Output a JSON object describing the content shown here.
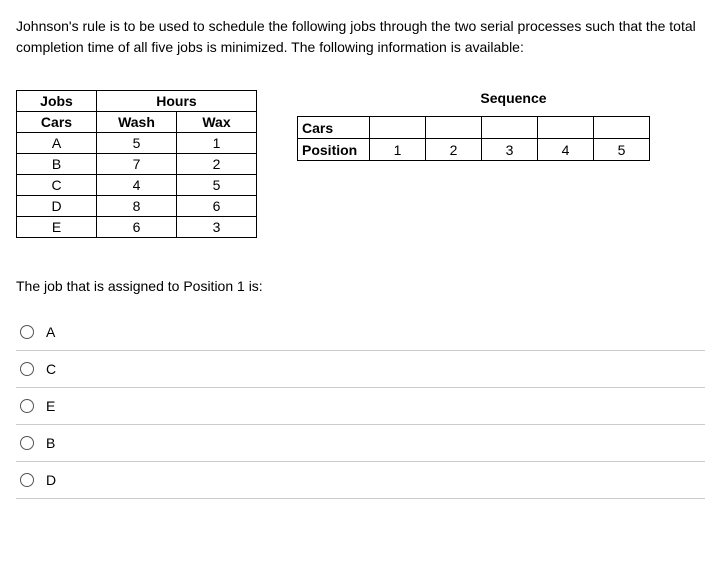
{
  "intro": "Johnson's rule is to be used to schedule the following jobs through the two serial processes such that the total completion time of all five jobs is minimized.  The following information is available:",
  "jobsTable": {
    "header1": {
      "jobs": "Jobs",
      "hours": "Hours"
    },
    "header2": {
      "cars": "Cars",
      "wash": "Wash",
      "wax": "Wax"
    },
    "rows": [
      {
        "car": "A",
        "wash": "5",
        "wax": "1"
      },
      {
        "car": "B",
        "wash": "7",
        "wax": "2"
      },
      {
        "car": "C",
        "wash": "4",
        "wax": "5"
      },
      {
        "car": "D",
        "wash": "8",
        "wax": "6"
      },
      {
        "car": "E",
        "wash": "6",
        "wax": "3"
      }
    ]
  },
  "sequence": {
    "title": "Sequence",
    "row1Label": "Cars",
    "row1": [
      "",
      "",
      "",
      "",
      ""
    ],
    "row2Label": "Position",
    "row2": [
      "1",
      "2",
      "3",
      "4",
      "5"
    ]
  },
  "question": "The job that is assigned to Position 1 is:",
  "options": [
    "A",
    "C",
    "E",
    "B",
    "D"
  ]
}
